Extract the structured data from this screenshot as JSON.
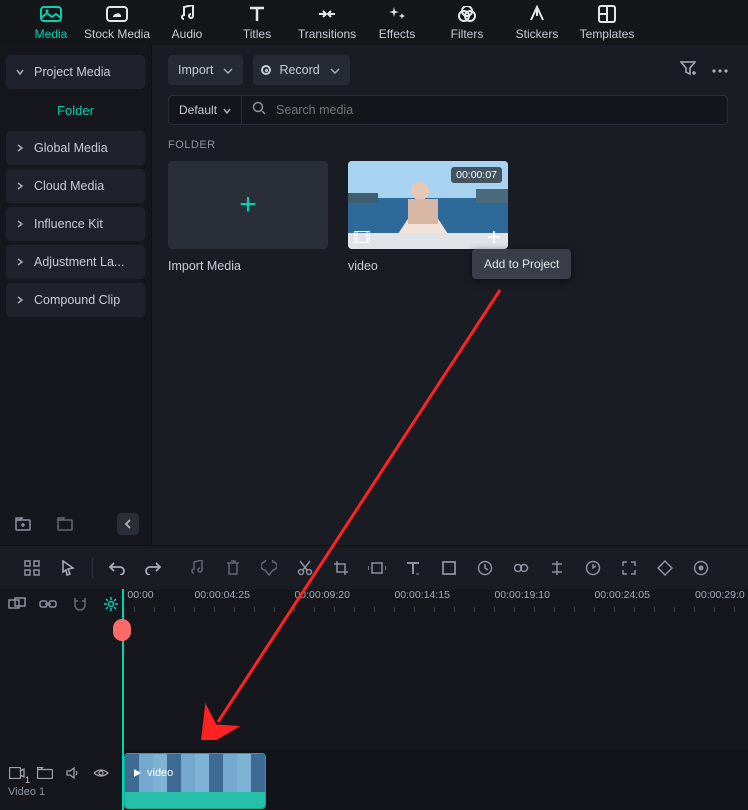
{
  "topnav": [
    {
      "label": "Media",
      "icon": "media",
      "active": true
    },
    {
      "label": "Stock Media",
      "icon": "stock"
    },
    {
      "label": "Audio",
      "icon": "audio"
    },
    {
      "label": "Titles",
      "icon": "titles"
    },
    {
      "label": "Transitions",
      "icon": "trans"
    },
    {
      "label": "Effects",
      "icon": "fx"
    },
    {
      "label": "Filters",
      "icon": "filters"
    },
    {
      "label": "Stickers",
      "icon": "stickers"
    },
    {
      "label": "Templates",
      "icon": "templates"
    }
  ],
  "sidebar": {
    "items": [
      {
        "label": "Project Media",
        "caret": "down"
      },
      {
        "label": "Folder",
        "active": true
      },
      {
        "label": "Global Media",
        "caret": "right"
      },
      {
        "label": "Cloud Media",
        "caret": "right"
      },
      {
        "label": "Influence Kit",
        "caret": "right"
      },
      {
        "label": "Adjustment La...",
        "caret": "right"
      },
      {
        "label": "Compound Clip",
        "caret": "right"
      }
    ]
  },
  "toolbar": {
    "import_label": "Import",
    "record_label": "Record"
  },
  "search": {
    "default_label": "Default",
    "placeholder": "Search media"
  },
  "folder_heading": "FOLDER",
  "cards": {
    "import": {
      "label": "Import Media"
    },
    "video": {
      "label": "video",
      "duration": "00:00:07"
    }
  },
  "tooltip": {
    "add_to_project": "Add to Project"
  },
  "ruler": {
    "ticks": [
      "00:00",
      "00:00:04:25",
      "00:00:09:20",
      "00:00:14:15",
      "00:00:19:10",
      "00:00:24:05",
      "00:00:29:0"
    ]
  },
  "track": {
    "name": "Video 1",
    "badge": "1"
  },
  "clip": {
    "label": "video"
  }
}
